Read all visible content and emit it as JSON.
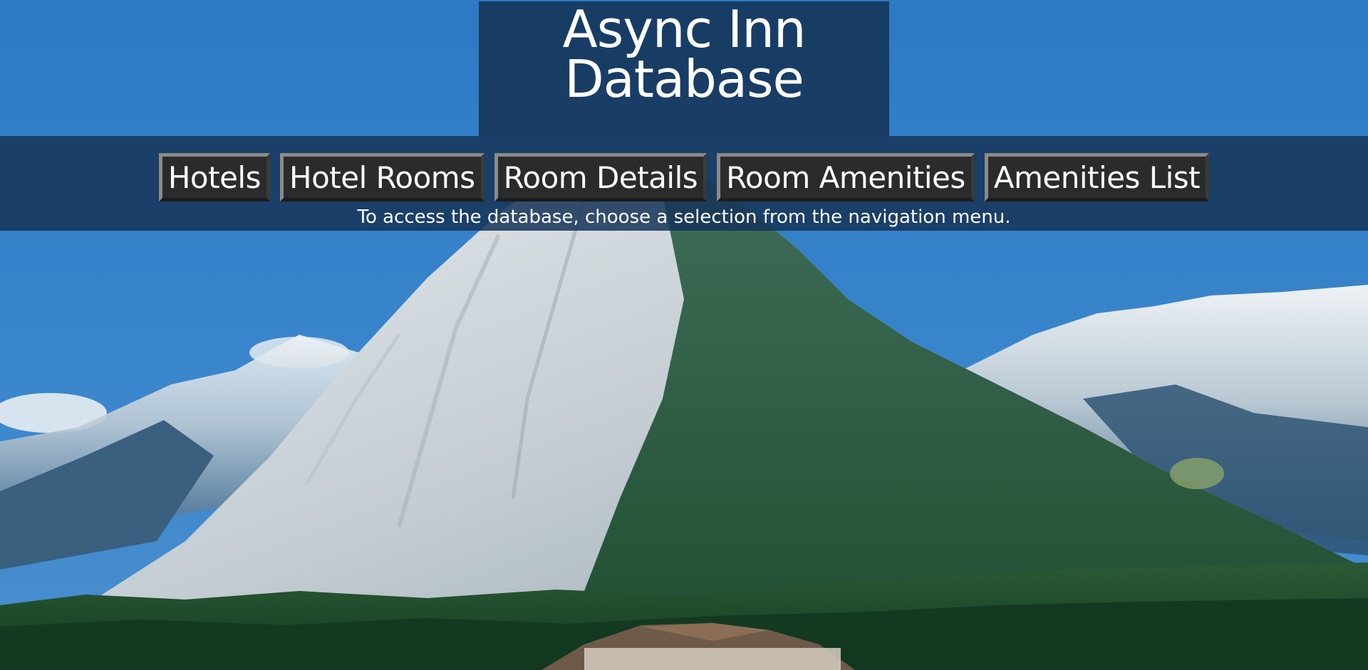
{
  "header": {
    "title_line1": "Async Inn",
    "title_line2": "Database"
  },
  "nav": {
    "items": [
      {
        "label": "Hotels"
      },
      {
        "label": "Hotel Rooms"
      },
      {
        "label": "Room Details"
      },
      {
        "label": "Room Amenities"
      },
      {
        "label": "Amenities List"
      }
    ]
  },
  "instructions": "To access the database, choose a selection from the navigation menu.",
  "colors": {
    "header_bg": "#163458",
    "nav_button_bg": "#2b2b2b",
    "sky": "#2f7cc6",
    "text": "#ffffff"
  },
  "background": {
    "icon": "mountain-landscape-photo"
  }
}
